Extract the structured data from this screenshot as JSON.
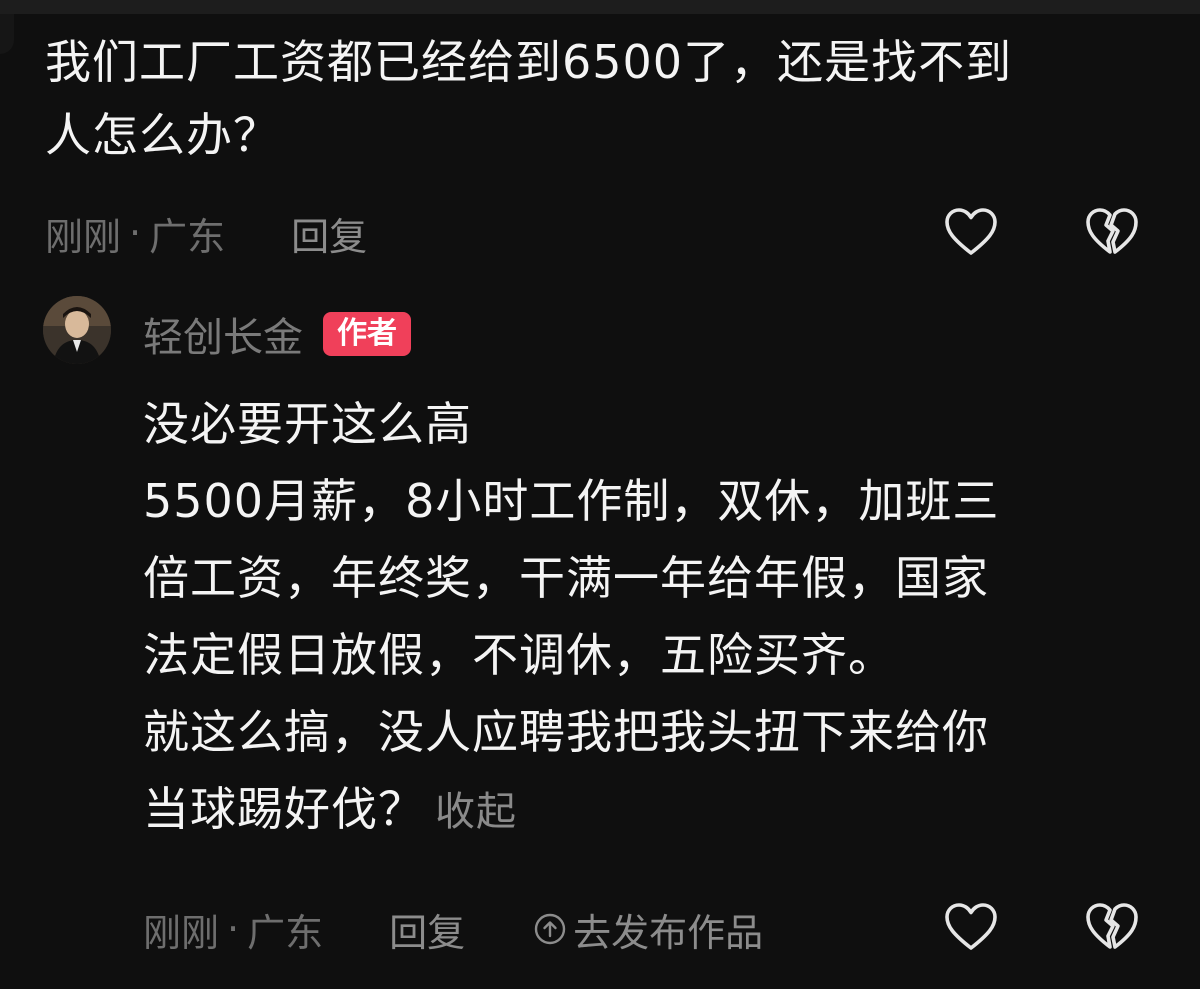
{
  "comment": {
    "text_line1": "我们工厂工资都已经给到6500了，还是找不到",
    "text_line2": "人怎么办？",
    "time": "刚刚",
    "location": "广东",
    "dot": "·",
    "reply_label": "回复"
  },
  "reply": {
    "username": "轻创长金",
    "badge": "作者",
    "lines": [
      "没必要开这么高",
      "5500月薪，8小时工作制，双休，加班三",
      "倍工资，年终奖，干满一年给年假，国家",
      "法定假日放假，不调休，五险买齐。",
      "就这么搞，没人应聘我把我头扭下来给你",
      "当球踢好伐？"
    ],
    "collapse_label": "收起",
    "time": "刚刚",
    "location": "广东",
    "dot": "·",
    "reply_label": "回复",
    "publish_label": "去发布作品"
  },
  "icons": {
    "like": "heart-outline-icon",
    "dislike": "broken-heart-icon",
    "publish": "upload-circle-icon"
  },
  "colors": {
    "background": "#0f0f0f",
    "text": "#f4f4f4",
    "meta": "#6e6e6e",
    "badge": "#f0405a"
  }
}
